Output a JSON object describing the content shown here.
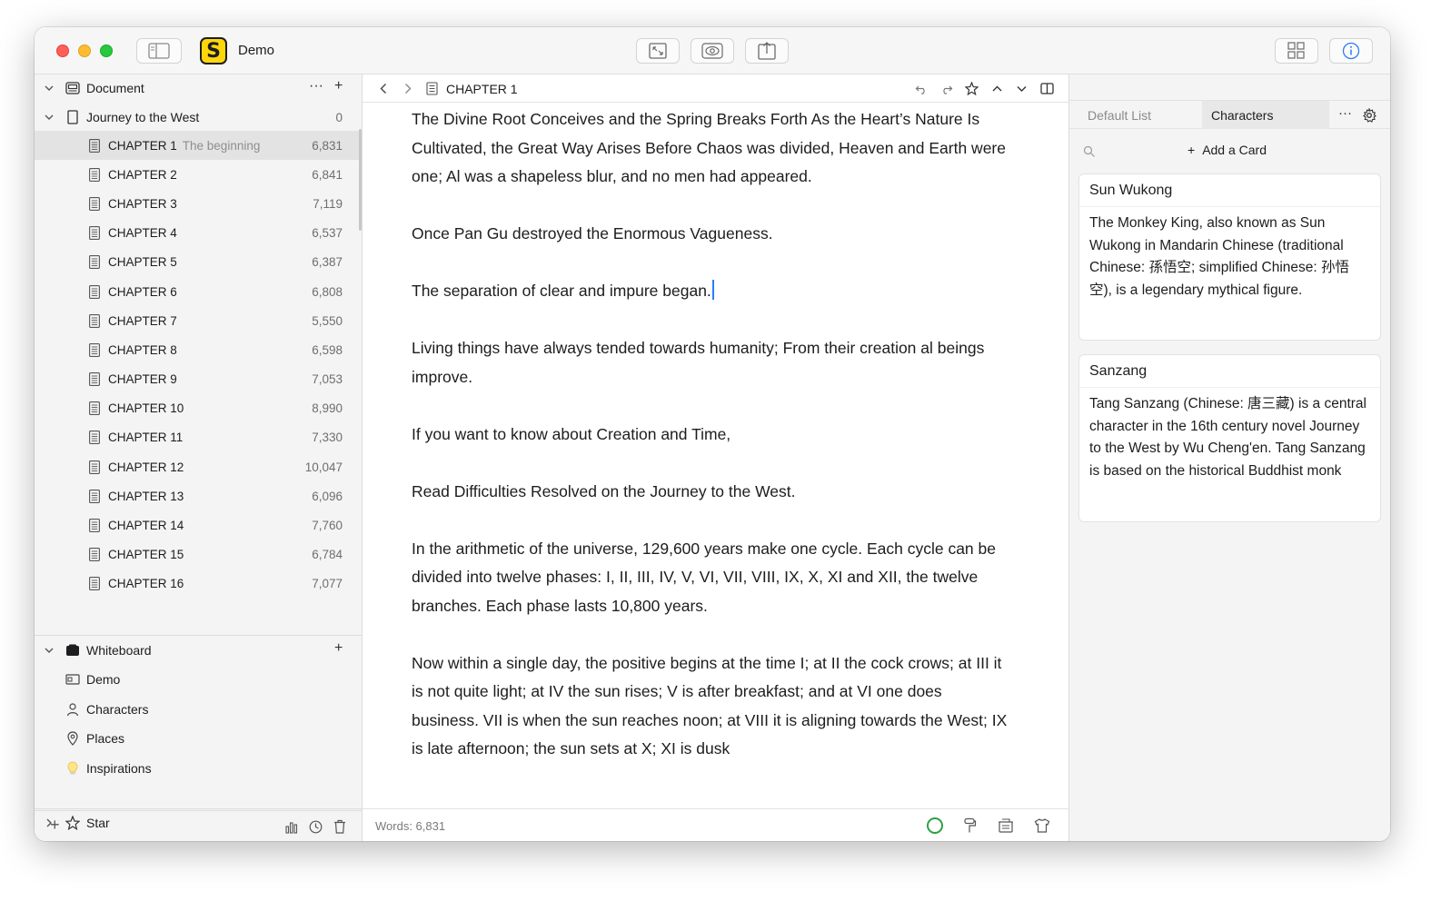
{
  "app": {
    "title": "Demo",
    "logo_letter": "S"
  },
  "sidebar": {
    "document_label": "Document",
    "project": {
      "label": "Journey to the West",
      "count": "0"
    },
    "chapters": [
      {
        "label": "CHAPTER 1",
        "subtitle": "The beginning",
        "count": "6,831",
        "selected": true
      },
      {
        "label": "CHAPTER 2",
        "subtitle": "",
        "count": "6,841"
      },
      {
        "label": "CHAPTER 3",
        "subtitle": "",
        "count": "7,119"
      },
      {
        "label": "CHAPTER 4",
        "subtitle": "",
        "count": "6,537"
      },
      {
        "label": "CHAPTER 5",
        "subtitle": "",
        "count": "6,387"
      },
      {
        "label": "CHAPTER 6",
        "subtitle": "",
        "count": "6,808"
      },
      {
        "label": "CHAPTER 7",
        "subtitle": "",
        "count": "5,550"
      },
      {
        "label": "CHAPTER 8",
        "subtitle": "",
        "count": "6,598"
      },
      {
        "label": "CHAPTER 9",
        "subtitle": "",
        "count": "7,053"
      },
      {
        "label": "CHAPTER 10",
        "subtitle": "",
        "count": "8,990"
      },
      {
        "label": "CHAPTER 11",
        "subtitle": "",
        "count": "7,330"
      },
      {
        "label": "CHAPTER 12",
        "subtitle": "",
        "count": "10,047"
      },
      {
        "label": "CHAPTER 13",
        "subtitle": "",
        "count": "6,096"
      },
      {
        "label": "CHAPTER 14",
        "subtitle": "",
        "count": "7,760"
      },
      {
        "label": "CHAPTER 15",
        "subtitle": "",
        "count": "6,784"
      },
      {
        "label": "CHAPTER 16",
        "subtitle": "",
        "count": "7,077"
      }
    ],
    "whiteboard_label": "Whiteboard",
    "whiteboard_items": [
      {
        "label": "Demo",
        "icon": "board-icon"
      },
      {
        "label": "Characters",
        "icon": "person-icon"
      },
      {
        "label": "Places",
        "icon": "location-pin-icon"
      },
      {
        "label": "Inspirations",
        "icon": "lightbulb-icon"
      }
    ],
    "star_label": "Star"
  },
  "editor": {
    "title": "CHAPTER 1",
    "paragraphs": [
      "The Divine Root Conceives and the Spring Breaks Forth As the Heart’s Nature Is Cultivated, the Great Way Arises Before Chaos was divided, Heaven and Earth were one; Al was a shapeless blur, and no men had appeared.",
      "Once Pan Gu destroyed the Enormous Vagueness.",
      "The separation of clear and impure began.",
      "Living things have always tended towards humanity; From their creation al beings improve.",
      "If you want to know about Creation and Time,",
      "Read Difficulties Resolved on the Journey to the West.",
      "In the arithmetic of the universe, 129,600 years make one cycle. Each cycle can be divided into twelve phases: I, II, III, IV, V, VI, VII, VIII, IX, X, XI and XII, the twelve branches. Each phase lasts 10,800 years.",
      "Now within a single day, the positive begins at the time I; at II the cock crows; at III it is not quite light; at IV the sun rises; V is after breakfast; and at VI one does business. VII is when the sun reaches noon; at VIII it is aligning towards the West; IX is late afternoon; the sun sets at X; XI is dusk"
    ],
    "words_label": "Words: 6,831"
  },
  "right_panel": {
    "tabs": [
      "Default List",
      "Characters"
    ],
    "active_tab": "Characters",
    "add_card_label": "Add a Card",
    "cards": [
      {
        "title": "Sun Wukong",
        "body": "The Monkey King, also known as Sun Wukong in Mandarin Chinese (traditional Chinese: 孫悟空; simplified Chinese: 孙悟空), is a legendary mythical figure."
      },
      {
        "title": "Sanzang",
        "body": "Tang Sanzang (Chinese: 唐三藏) is a central character in the 16th century novel Journey to the West by Wu Cheng'en. Tang Sanzang is based on the historical Buddhist monk"
      }
    ]
  },
  "colors": {
    "accent_caret": "#2f7cf6",
    "status_ring": "#2ea043",
    "logo_yellow": "#ffd60a"
  }
}
